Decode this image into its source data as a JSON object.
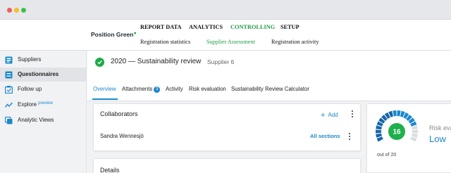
{
  "header": {
    "logo_text": "Position Green",
    "main_nav": [
      {
        "label": "REPORT DATA",
        "active": false
      },
      {
        "label": "ANALYTICS",
        "active": false
      },
      {
        "label": "CONTROLLING",
        "active": true
      },
      {
        "label": "SETUP",
        "active": false
      }
    ],
    "sub_nav": [
      {
        "label": "Registration statistics",
        "active": false
      },
      {
        "label": "Supplier Assessment",
        "active": true
      },
      {
        "label": "Registration activity",
        "active": false
      }
    ]
  },
  "sidebar": {
    "items": [
      {
        "label": "Suppliers",
        "icon": "suppliers-icon",
        "active": false
      },
      {
        "label": "Questionnaires",
        "icon": "questionnaire-icon",
        "active": true
      },
      {
        "label": "Follow up",
        "icon": "follow-up-icon",
        "active": false
      },
      {
        "label": "Explore",
        "sup": "preview",
        "icon": "explore-icon",
        "active": false
      },
      {
        "label": "Analytic Views",
        "icon": "analytic-views-icon",
        "active": false
      }
    ]
  },
  "page": {
    "title": "2020 — Sustainability review",
    "supplier": "Supplier 6",
    "tabs": [
      {
        "label": "Overview",
        "active": true
      },
      {
        "label": "Attachments",
        "badge": "3",
        "active": false
      },
      {
        "label": "Activity",
        "active": false
      },
      {
        "label": "Risk evaluation",
        "active": false
      },
      {
        "label": "Sustainability Review Calculator",
        "active": false
      }
    ]
  },
  "collaborators": {
    "title": "Collaborators",
    "add_label": "Add",
    "person": "Sandra Wennesjö",
    "scope": "All sections"
  },
  "details": {
    "title": "Details"
  },
  "risk": {
    "score": "16",
    "out_of": "out of 20",
    "label": "Risk eva",
    "value": "Low"
  },
  "colors": {
    "accent_green": "#1e9e43",
    "accent_blue": "#1a88c9",
    "gauge_dark": "#1766a8"
  }
}
